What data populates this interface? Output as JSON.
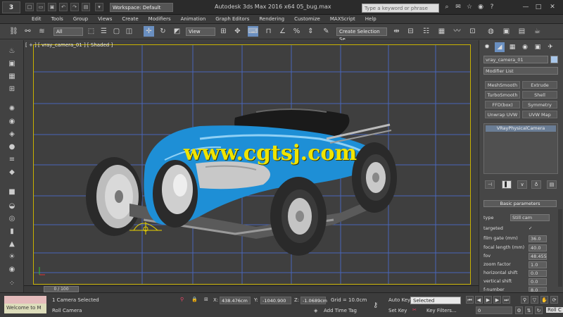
{
  "titlebar": {
    "logo": "3",
    "workspace": "Workspace: Default",
    "title": "Autodesk 3ds Max 2016 x64     05_bug.max",
    "search_placeholder": "Type a keyword or phrase"
  },
  "menu": [
    "Edit",
    "Tools",
    "Group",
    "Views",
    "Create",
    "Modifiers",
    "Animation",
    "Graph Editors",
    "Rendering",
    "Customize",
    "MAXScript",
    "Help"
  ],
  "toolbar": {
    "selection_filter": "All",
    "ref_coord": "View",
    "named_selection": "Create Selection Se"
  },
  "viewport": {
    "label": "[ + ] [ vray_camera_01 ] [ Shaded ]",
    "watermark": "www.cgtsj.com",
    "frame_counter": "0 / 100"
  },
  "status": {
    "listener": "Welcome to M",
    "selection_status": "1 Camera Selected",
    "prompt": "Roll Camera",
    "x_label": "X:",
    "x_value": "438.476cm",
    "y_label": "Y:",
    "y_value": "-1040.900",
    "z_label": "Z:",
    "z_value": "-1.0689cm",
    "grid": "Grid = 10.0cm",
    "add_time_tag": "Add Time Tag",
    "auto_key_label": "Auto Key",
    "auto_key_value": "Selected",
    "set_key": "Set Key",
    "key_filters": "Key Filters...",
    "frame_field": "0",
    "roll_camera": "Roll C"
  },
  "command_panel": {
    "object_name": "vray_camera_01",
    "object_color": "#a9c7ea",
    "modifier_list": "Modifier List",
    "modifier_buttons": [
      "MeshSmooth",
      "Extrude",
      "TurboSmooth",
      "Shell",
      "FFD(box)",
      "Symmetry",
      "Unwrap UVW",
      "UVW Map"
    ],
    "stack_item": "VRayPhysicalCamera",
    "rollout_title": "Basic parameters",
    "params": [
      {
        "label": "type",
        "value": "Still cam"
      },
      {
        "label": "targeted",
        "value": "✓"
      },
      {
        "label": "film gate (mm)",
        "value": "36.0"
      },
      {
        "label": "focal length (mm)",
        "value": "40.0"
      },
      {
        "label": "fov",
        "value": "48.455"
      },
      {
        "label": "zoom factor",
        "value": "1.0"
      },
      {
        "label": "horizontal shift",
        "value": "0.0"
      },
      {
        "label": "vertical shift",
        "value": "0.0"
      },
      {
        "label": "f-number",
        "value": "8.0"
      }
    ]
  },
  "colors": {
    "safe_frame": "#c9b200",
    "grid_line": "#4a6cd0",
    "car_body": "#1e8fd6",
    "watermark": "#f0e400"
  }
}
